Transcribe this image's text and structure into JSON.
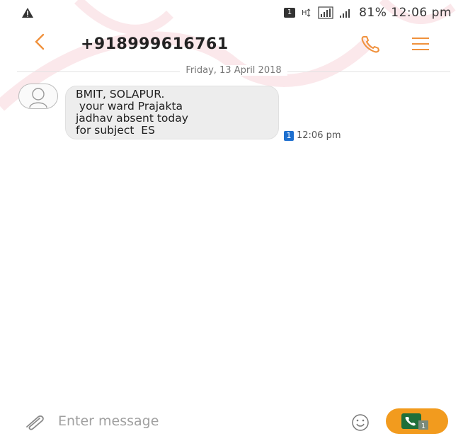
{
  "status_bar": {
    "sim_label": "1",
    "text": "81% 12:06 pm"
  },
  "header": {
    "contact": "+918999616761"
  },
  "conversation": {
    "date": "Friday, 13 April 2018",
    "messages": [
      {
        "lines": [
          "BMIT, SOLAPUR.",
          " your ward Prajakta",
          "jadhav absent today",
          "for subject  ES"
        ],
        "sim": "1",
        "time": "12:06 pm"
      }
    ]
  },
  "composer": {
    "placeholder": "Enter message",
    "send_sim": "1"
  },
  "colors": {
    "accent": "#f0913c",
    "send_button": "#f29b1e",
    "sim_badge": "#1d6fcf",
    "bubble": "#ededed"
  },
  "icons": {
    "back": "chevron-left-icon",
    "call": "phone-icon",
    "menu": "hamburger-menu-icon",
    "attach": "paperclip-icon",
    "emoji": "smiley-icon",
    "send": "phone-call-icon"
  }
}
